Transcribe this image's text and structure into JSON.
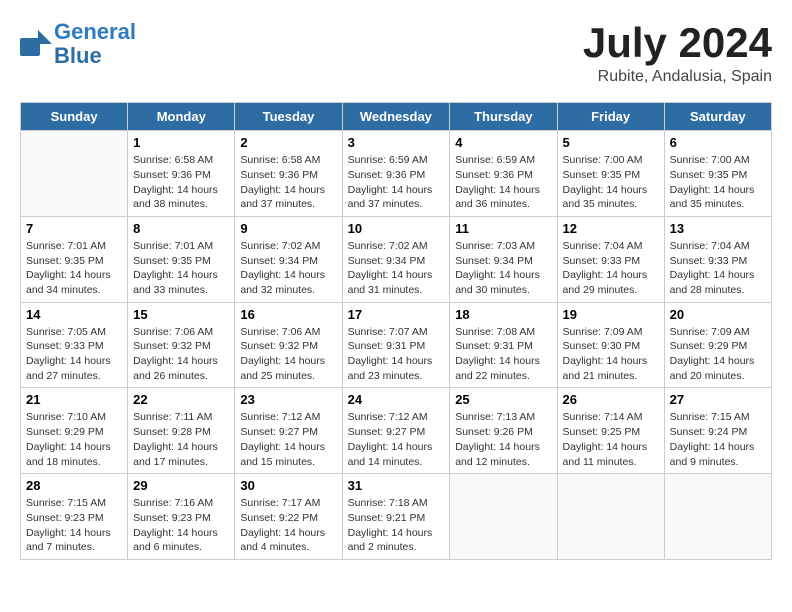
{
  "header": {
    "logo_line1": "General",
    "logo_line2": "Blue",
    "month_title": "July 2024",
    "location": "Rubite, Andalusia, Spain"
  },
  "weekdays": [
    "Sunday",
    "Monday",
    "Tuesday",
    "Wednesday",
    "Thursday",
    "Friday",
    "Saturday"
  ],
  "weeks": [
    [
      {
        "day": "",
        "info": ""
      },
      {
        "day": "1",
        "info": "Sunrise: 6:58 AM\nSunset: 9:36 PM\nDaylight: 14 hours\nand 38 minutes."
      },
      {
        "day": "2",
        "info": "Sunrise: 6:58 AM\nSunset: 9:36 PM\nDaylight: 14 hours\nand 37 minutes."
      },
      {
        "day": "3",
        "info": "Sunrise: 6:59 AM\nSunset: 9:36 PM\nDaylight: 14 hours\nand 37 minutes."
      },
      {
        "day": "4",
        "info": "Sunrise: 6:59 AM\nSunset: 9:36 PM\nDaylight: 14 hours\nand 36 minutes."
      },
      {
        "day": "5",
        "info": "Sunrise: 7:00 AM\nSunset: 9:35 PM\nDaylight: 14 hours\nand 35 minutes."
      },
      {
        "day": "6",
        "info": "Sunrise: 7:00 AM\nSunset: 9:35 PM\nDaylight: 14 hours\nand 35 minutes."
      }
    ],
    [
      {
        "day": "7",
        "info": "Sunrise: 7:01 AM\nSunset: 9:35 PM\nDaylight: 14 hours\nand 34 minutes."
      },
      {
        "day": "8",
        "info": "Sunrise: 7:01 AM\nSunset: 9:35 PM\nDaylight: 14 hours\nand 33 minutes."
      },
      {
        "day": "9",
        "info": "Sunrise: 7:02 AM\nSunset: 9:34 PM\nDaylight: 14 hours\nand 32 minutes."
      },
      {
        "day": "10",
        "info": "Sunrise: 7:02 AM\nSunset: 9:34 PM\nDaylight: 14 hours\nand 31 minutes."
      },
      {
        "day": "11",
        "info": "Sunrise: 7:03 AM\nSunset: 9:34 PM\nDaylight: 14 hours\nand 30 minutes."
      },
      {
        "day": "12",
        "info": "Sunrise: 7:04 AM\nSunset: 9:33 PM\nDaylight: 14 hours\nand 29 minutes."
      },
      {
        "day": "13",
        "info": "Sunrise: 7:04 AM\nSunset: 9:33 PM\nDaylight: 14 hours\nand 28 minutes."
      }
    ],
    [
      {
        "day": "14",
        "info": "Sunrise: 7:05 AM\nSunset: 9:33 PM\nDaylight: 14 hours\nand 27 minutes."
      },
      {
        "day": "15",
        "info": "Sunrise: 7:06 AM\nSunset: 9:32 PM\nDaylight: 14 hours\nand 26 minutes."
      },
      {
        "day": "16",
        "info": "Sunrise: 7:06 AM\nSunset: 9:32 PM\nDaylight: 14 hours\nand 25 minutes."
      },
      {
        "day": "17",
        "info": "Sunrise: 7:07 AM\nSunset: 9:31 PM\nDaylight: 14 hours\nand 23 minutes."
      },
      {
        "day": "18",
        "info": "Sunrise: 7:08 AM\nSunset: 9:31 PM\nDaylight: 14 hours\nand 22 minutes."
      },
      {
        "day": "19",
        "info": "Sunrise: 7:09 AM\nSunset: 9:30 PM\nDaylight: 14 hours\nand 21 minutes."
      },
      {
        "day": "20",
        "info": "Sunrise: 7:09 AM\nSunset: 9:29 PM\nDaylight: 14 hours\nand 20 minutes."
      }
    ],
    [
      {
        "day": "21",
        "info": "Sunrise: 7:10 AM\nSunset: 9:29 PM\nDaylight: 14 hours\nand 18 minutes."
      },
      {
        "day": "22",
        "info": "Sunrise: 7:11 AM\nSunset: 9:28 PM\nDaylight: 14 hours\nand 17 minutes."
      },
      {
        "day": "23",
        "info": "Sunrise: 7:12 AM\nSunset: 9:27 PM\nDaylight: 14 hours\nand 15 minutes."
      },
      {
        "day": "24",
        "info": "Sunrise: 7:12 AM\nSunset: 9:27 PM\nDaylight: 14 hours\nand 14 minutes."
      },
      {
        "day": "25",
        "info": "Sunrise: 7:13 AM\nSunset: 9:26 PM\nDaylight: 14 hours\nand 12 minutes."
      },
      {
        "day": "26",
        "info": "Sunrise: 7:14 AM\nSunset: 9:25 PM\nDaylight: 14 hours\nand 11 minutes."
      },
      {
        "day": "27",
        "info": "Sunrise: 7:15 AM\nSunset: 9:24 PM\nDaylight: 14 hours\nand 9 minutes."
      }
    ],
    [
      {
        "day": "28",
        "info": "Sunrise: 7:15 AM\nSunset: 9:23 PM\nDaylight: 14 hours\nand 7 minutes."
      },
      {
        "day": "29",
        "info": "Sunrise: 7:16 AM\nSunset: 9:23 PM\nDaylight: 14 hours\nand 6 minutes."
      },
      {
        "day": "30",
        "info": "Sunrise: 7:17 AM\nSunset: 9:22 PM\nDaylight: 14 hours\nand 4 minutes."
      },
      {
        "day": "31",
        "info": "Sunrise: 7:18 AM\nSunset: 9:21 PM\nDaylight: 14 hours\nand 2 minutes."
      },
      {
        "day": "",
        "info": ""
      },
      {
        "day": "",
        "info": ""
      },
      {
        "day": "",
        "info": ""
      }
    ]
  ]
}
